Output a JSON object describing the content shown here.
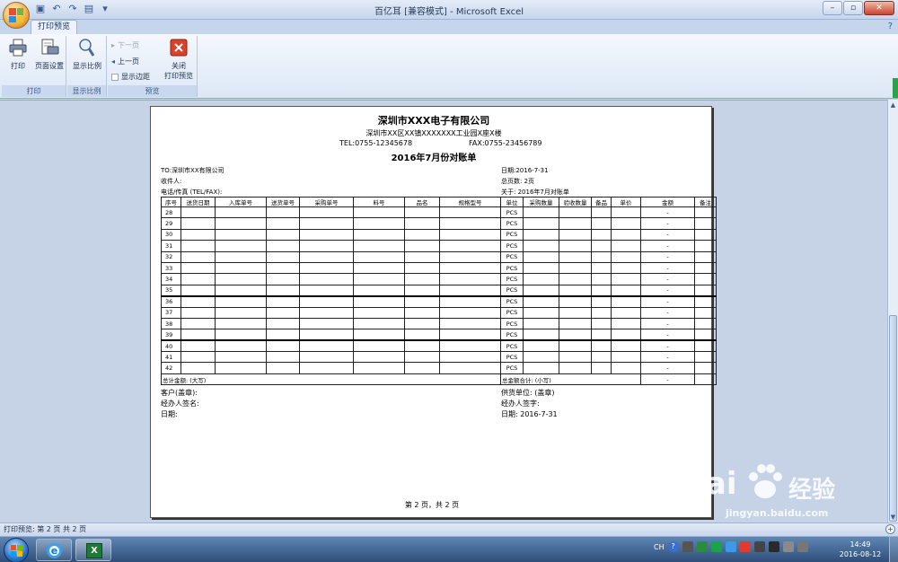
{
  "window": {
    "title": "百亿耳  [兼容模式] - Microsoft Excel",
    "min": "–",
    "max": "▫",
    "close": "✕"
  },
  "ribbon": {
    "tab": "打印预览",
    "help": "?",
    "print_group": {
      "label": "打印",
      "print": "打印",
      "page_setup": "页面设置"
    },
    "zoom_group": {
      "label": "显示比例",
      "zoom": "显示比例"
    },
    "preview_group": {
      "label": "预览",
      "next_page": "下一页",
      "prev_page": "上一页",
      "show_margins": "显示边距",
      "close_line1": "关闭",
      "close_line2": "打印预览"
    }
  },
  "doc": {
    "company": "深圳市XXX电子有限公司",
    "address": "深圳市XX区XX镇XXXXXXX工业园X座X楼",
    "tel": "TEL:0755-12345678",
    "fax": "FAX:0755-23456789",
    "title": "2016年7月份对账单",
    "to": "TO:深圳市XX有限公司",
    "date": "日期:2016-7-31",
    "receiver": "收件人:",
    "total_pages": "总页数: 2页",
    "phone_fax": "电话/传真 (TEL/FAX):",
    "about": "关于: 2016年7月对账单",
    "headers": [
      "序号",
      "送货日期",
      "入库单号",
      "送货单号",
      "采购单号",
      "料号",
      "品名",
      "规格型号",
      "单位",
      "采购数量",
      "验收数量",
      "备品",
      "单价",
      "金额",
      "备注"
    ],
    "rows": [
      {
        "no": "28",
        "unit": "PCS",
        "amount": "-"
      },
      {
        "no": "29",
        "unit": "PCS",
        "amount": "-"
      },
      {
        "no": "30",
        "unit": "PCS",
        "amount": "-"
      },
      {
        "no": "31",
        "unit": "PCS",
        "amount": "-"
      },
      {
        "no": "32",
        "unit": "PCS",
        "amount": "-"
      },
      {
        "no": "33",
        "unit": "PCS",
        "amount": "-"
      },
      {
        "no": "34",
        "unit": "PCS",
        "amount": "-"
      },
      {
        "no": "35",
        "unit": "PCS",
        "amount": "-"
      },
      {
        "no": "36",
        "unit": "PCS",
        "amount": "-"
      },
      {
        "no": "37",
        "unit": "PCS",
        "amount": "-"
      },
      {
        "no": "38",
        "unit": "PCS",
        "amount": "-"
      },
      {
        "no": "39",
        "unit": "PCS",
        "amount": "-"
      },
      {
        "no": "40",
        "unit": "PCS",
        "amount": "-"
      },
      {
        "no": "41",
        "unit": "PCS",
        "amount": "-"
      },
      {
        "no": "42",
        "unit": "PCS",
        "amount": "-"
      }
    ],
    "total_caps": "总计金额: (大写)",
    "total_small": "总金额合计: (小写)",
    "total_amount": "-",
    "customer_seal": "客户(盖章):",
    "supplier_seal": "供货单位: (盖章)",
    "customer_sign": "经办人签名:",
    "supplier_sign": "经办人签字:",
    "customer_date": "日期:",
    "supplier_date": "日期: 2016-7-31",
    "page_footer": "第 2 页，共 2 页"
  },
  "status": {
    "text": "打印预览: 第 2 页  共 2 页",
    "zoom_in": "+"
  },
  "taskbar": {
    "ime": "CH",
    "help": "?",
    "time": "14:49",
    "date": "2016-08-12"
  },
  "watermark": {
    "brand": "Bai",
    "brand2": "经验",
    "url": "jingyan.baidu.com"
  },
  "colors": {
    "ribbon_bg": "#dce7f6",
    "preview_bg": "#c6d3e6",
    "taskbar": "#2e4e79",
    "excel_green": "#1f7a3a"
  }
}
